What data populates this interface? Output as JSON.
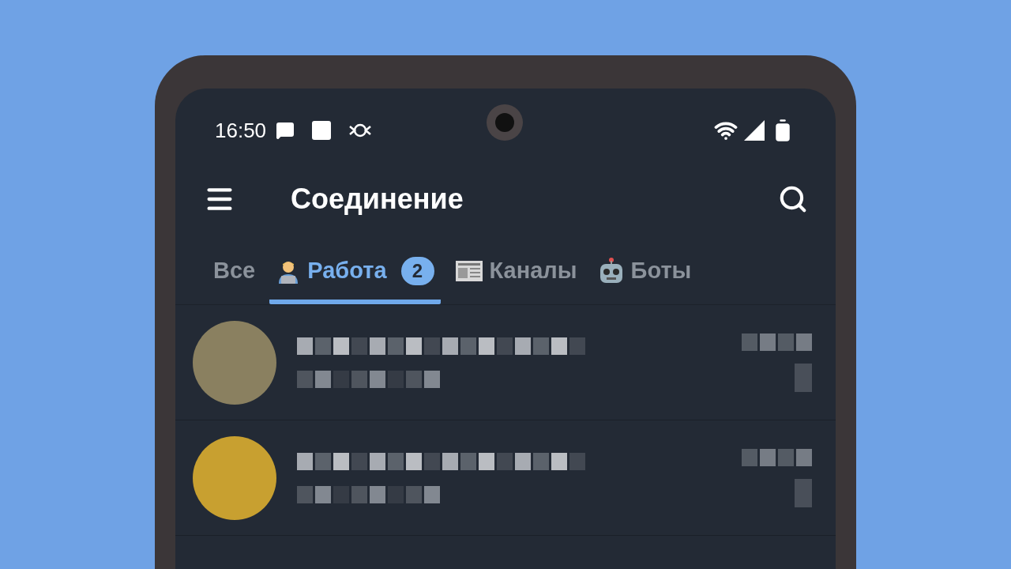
{
  "status_bar": {
    "time": "16:50"
  },
  "header": {
    "title": "Соединение"
  },
  "tabs": [
    {
      "label": "Все",
      "kind": "plain",
      "selected": false
    },
    {
      "label": "Работа",
      "kind": "worker",
      "badge": "2",
      "selected": true
    },
    {
      "label": "Каналы",
      "kind": "newspaper",
      "selected": false
    },
    {
      "label": "Боты",
      "kind": "robot",
      "selected": false
    }
  ],
  "chats": [
    {
      "color": "#8a8060"
    },
    {
      "color": "#c8a030"
    }
  ]
}
